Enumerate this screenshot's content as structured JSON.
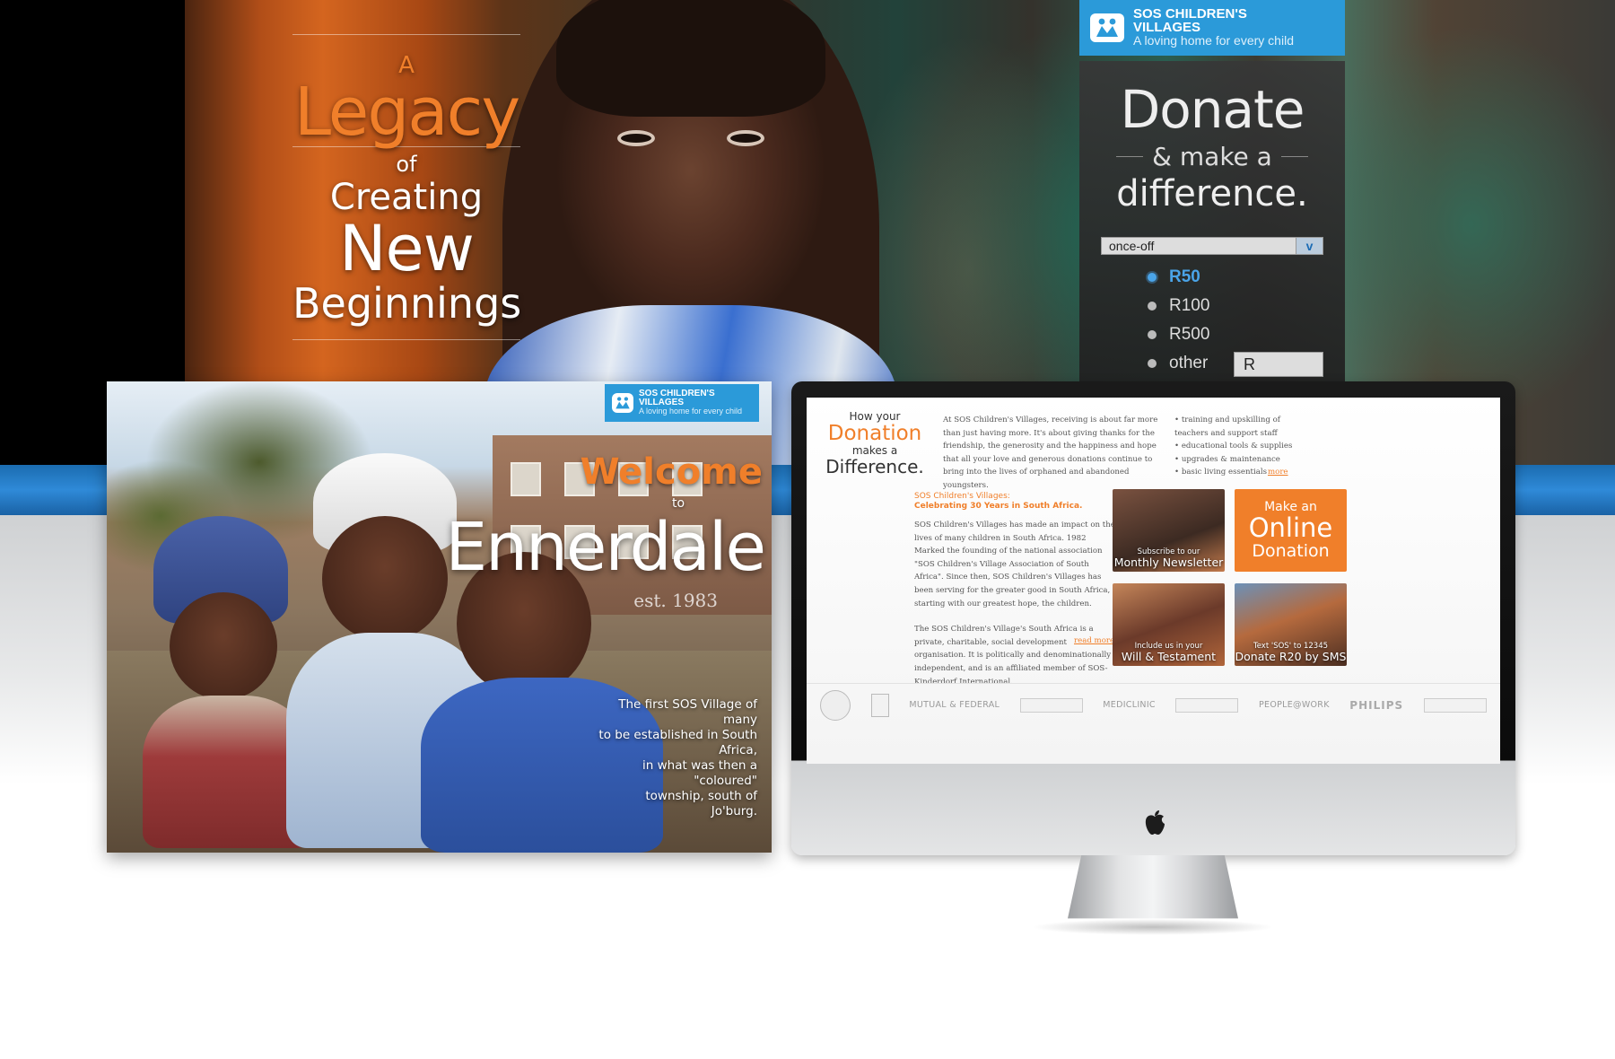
{
  "hero": {
    "headline": {
      "a": "A",
      "legacy": "Legacy",
      "of": "of",
      "creating": "Creating",
      "new": "New",
      "beginnings": "Beginnings"
    },
    "logo": {
      "name_line1": "SOS CHILDREN'S",
      "name_line2": "VILLAGES",
      "tagline": "A loving home for every child"
    },
    "donate": {
      "title": "Donate",
      "subtitle": "& make a",
      "line3": "difference.",
      "frequency": "once-off",
      "frequency_arrow": "v",
      "options": [
        {
          "label": "R50",
          "selected": true
        },
        {
          "label": "R100",
          "selected": false
        },
        {
          "label": "R500",
          "selected": false
        },
        {
          "label": "other",
          "selected": false
        }
      ],
      "other_prefix": "R"
    }
  },
  "brochure": {
    "logo": {
      "name_line1": "SOS CHILDREN'S",
      "name_line2": "VILLAGES",
      "tagline": "A loving home for every child"
    },
    "welcome": "Welcome",
    "to": "to",
    "place": "Ennerdale",
    "est": "est. 1983",
    "caption_lines": [
      "The first SOS Village of many",
      "to be established in South Africa,",
      "in what was then a \"coloured\"",
      "township, south of Jo'burg."
    ]
  },
  "screen": {
    "how": {
      "l1": "How your",
      "l2": "Donation",
      "l3": "makes a",
      "l4": "Difference."
    },
    "intro": "At SOS Children's Villages, receiving is about far more than just having more. It's about giving thanks for the friendship, the generosity and the happiness and hope that all your love and generous donations continue to bring into the lives of orphaned and abandoned youngsters.",
    "bullets": [
      "training and upskilling of teachers and support staff",
      "educational tools & supplies",
      "upgrades & maintenance",
      "basic living essentials"
    ],
    "more": "more",
    "celebrate": {
      "l1": "SOS Children's Villages:",
      "l2": "Celebrating 30 Years in South Africa."
    },
    "para1": "SOS Children's Villages has made an impact on the lives of many children in South Africa. 1982 Marked the founding of the national association \"SOS Children's Village Association of South Africa\". Since then, SOS Children's Villages has been serving for the greater good in South Africa, starting with our greatest hope, the children.",
    "para2": "The SOS Children's Village's South Africa is a private, charitable, social development organisation. It is politically and denominationally independent, and is an affiliated member of SOS-Kinderdorf International.",
    "read_more": "read more",
    "tiles": {
      "newsletter": {
        "small": "Subscribe to our",
        "big": "Monthly Newsletter"
      },
      "online": {
        "l1": "Make an",
        "l2": "Online",
        "l3": "Donation"
      },
      "will": {
        "small": "Include us in your",
        "big": "Will & Testament"
      },
      "sms": {
        "small": "Text 'SOS' to 12345",
        "big": "Donate R20 by SMS"
      }
    },
    "sponsors": [
      "MUTUAL & FEDERAL",
      "MEDICLINIC",
      "PEOPLE@WORK",
      "PHILIPS"
    ]
  },
  "colors": {
    "orange": "#f07f2a",
    "sos_blue": "#2b9ad9",
    "stripe_blue": "#2f8ad8"
  }
}
